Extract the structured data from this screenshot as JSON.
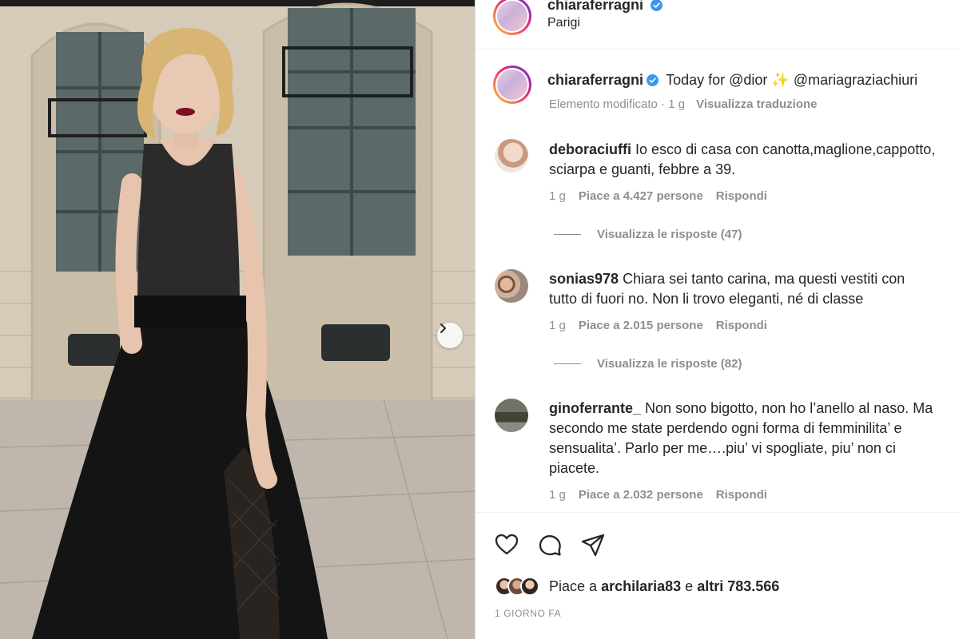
{
  "post": {
    "author": "chiaraferragni",
    "location": "Parigi",
    "caption": "Today for @dior ✨ @mariagraziachiuri",
    "caption_meta": {
      "status": "Elemento modificato · 1 g",
      "translate_label": "Visualizza traduzione"
    }
  },
  "comments": [
    {
      "username": "deboraciuffi",
      "text": "Io esco di casa con canotta,maglione,cappotto,\nsciarpa e guanti, febbre a 39.",
      "time": "1 g",
      "likes": "Piace a 4.427 persone",
      "reply_label": "Rispondi",
      "view_replies": "Visualizza le risposte (47)"
    },
    {
      "username": "sonias978",
      "text": "Chiara sei tanto carina, ma questi vestiti con\ntutto di fuori no. Non li trovo eleganti, né di classe",
      "time": "1 g",
      "likes": "Piace a 2.015 persone",
      "reply_label": "Rispondi",
      "view_replies": "Visualizza le risposte (82)"
    },
    {
      "username": "ginoferrante_",
      "text": "Non sono bigotto, non ho l’anello al naso. Ma\nsecondo me state perdendo ogni forma di femminilita’ e\nsensualita’. Parlo per me….piu’ vi spogliate, piu’ non ci\npiacete.",
      "time": "1 g",
      "likes": "Piace a 2.032 persone",
      "reply_label": "Rispondi"
    }
  ],
  "actions": {
    "icons": [
      "heart-icon",
      "comment-icon",
      "share-icon"
    ]
  },
  "likes_summary": {
    "prefix": "Piace a",
    "user": "archilaria83",
    "connector": "e",
    "others": "altri 783.566"
  },
  "timestamp": "1 giorno fa",
  "colors": {
    "accent_blue": "#3897f0",
    "muted": "#8e8e8e",
    "text": "#262626"
  }
}
